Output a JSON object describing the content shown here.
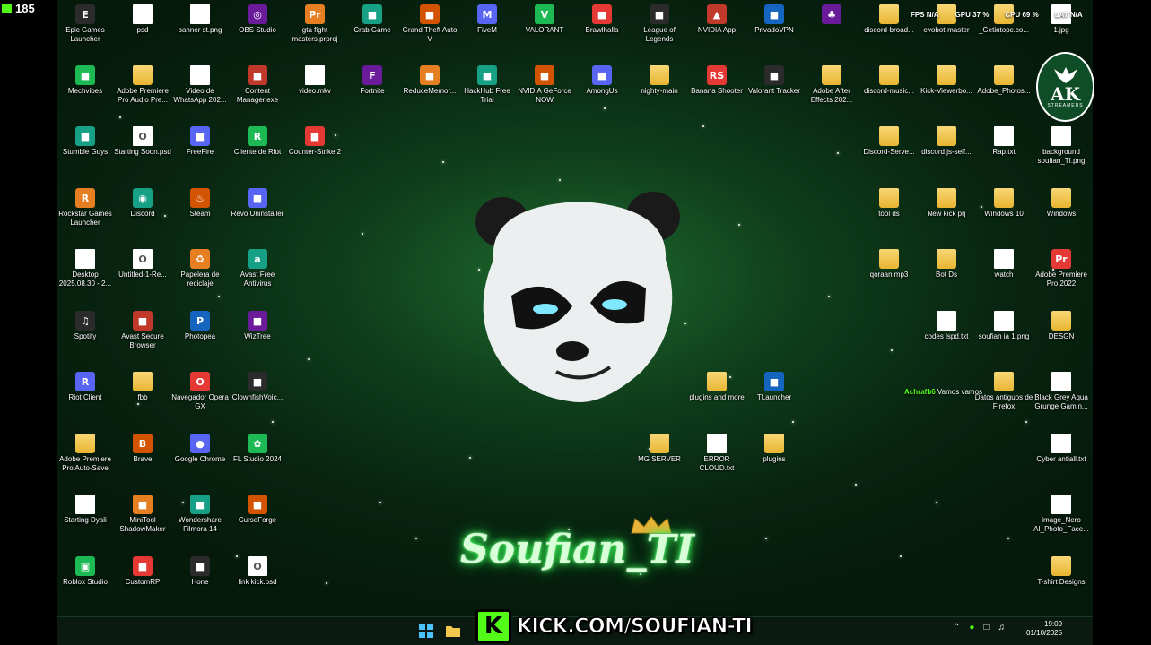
{
  "viewer_count": "185",
  "perf_overlay": {
    "fps": "FPS N/A",
    "gpu": "GPU 37 %",
    "cpu": "CPU 69 %",
    "lat": "LAT N/A"
  },
  "ak_logo": {
    "text": "AK",
    "subtext": "STREAMERS"
  },
  "streamer_name": "Soufian_TI",
  "chat": {
    "user": "Achrafb6",
    "message": "Vamos vamos"
  },
  "kick_banner": {
    "url": "KICK.COM/SOUFIAN-TI"
  },
  "clock": {
    "time": "19:09",
    "date": "01/10/2025"
  },
  "colors": {
    "kick_green": "#53fc18",
    "desktop_green": "#0f3d1a"
  },
  "desktop_icons": [
    {
      "label": "Epic Games Launcher",
      "icon": "epic-games-icon",
      "type": "app"
    },
    {
      "label": "psd",
      "icon": "file-icon",
      "type": "file"
    },
    {
      "label": "banner st.png",
      "icon": "image-file-icon",
      "type": "file"
    },
    {
      "label": "OBS Studio",
      "icon": "obs-icon",
      "type": "app"
    },
    {
      "label": "gta fight masters.prproj",
      "icon": "premiere-project-icon",
      "type": "app"
    },
    {
      "label": "Crab Game",
      "icon": "crab-game-icon",
      "type": "app"
    },
    {
      "label": "Grand Theft Auto V",
      "icon": "gta-icon",
      "type": "app"
    },
    {
      "label": "FiveM",
      "icon": "fivem-icon",
      "type": "app"
    },
    {
      "label": "VALORANT",
      "icon": "valorant-icon",
      "type": "app"
    },
    {
      "label": "Brawlhalla",
      "icon": "brawlhalla-icon",
      "type": "app"
    },
    {
      "label": "League of Legends",
      "icon": "league-icon",
      "type": "app"
    },
    {
      "label": "NVIDIA App",
      "icon": "nvidia-icon",
      "type": "app"
    },
    {
      "label": "PrivadoVPN",
      "icon": "vpn-icon",
      "type": "app"
    },
    {
      "label": "",
      "icon": "tree-icon",
      "type": "app"
    },
    {
      "label": "discord-broad...",
      "icon": "folder-icon",
      "type": "folder"
    },
    {
      "label": "evobot-master",
      "icon": "folder-icon",
      "type": "folder"
    },
    {
      "label": "_Getintopc.co...",
      "icon": "folder-icon",
      "type": "folder"
    },
    {
      "label": "1.jpg",
      "icon": "image-file-icon",
      "type": "file"
    },
    {
      "label": "Mechvibes",
      "icon": "mechvibes-icon",
      "type": "app"
    },
    {
      "label": "Adobe Premiere Pro Audio Pre...",
      "icon": "folder-icon",
      "type": "folder"
    },
    {
      "label": "Video de WhatsApp 202...",
      "icon": "video-file-icon",
      "type": "file"
    },
    {
      "label": "Content Manager.exe",
      "icon": "content-manager-icon",
      "type": "app"
    },
    {
      "label": "video.mkv",
      "icon": "video-file-icon",
      "type": "file"
    },
    {
      "label": "Fortnite",
      "icon": "fortnite-icon",
      "type": "app"
    },
    {
      "label": "ReduceMemor...",
      "icon": "ram-icon",
      "type": "app"
    },
    {
      "label": "HackHub Free Trial",
      "icon": "hackhub-icon",
      "type": "app"
    },
    {
      "label": "NVIDIA GeForce NOW",
      "icon": "geforce-now-icon",
      "type": "app"
    },
    {
      "label": "AmongUs",
      "icon": "among-us-icon",
      "type": "app"
    },
    {
      "label": "nighty-main",
      "icon": "folder-icon",
      "type": "folder"
    },
    {
      "label": "Banana Shooter",
      "icon": "banana-shooter-icon",
      "type": "app"
    },
    {
      "label": "Valorant Tracker",
      "icon": "valorant-tracker-icon",
      "type": "app"
    },
    {
      "label": "Adobe After Effects 202...",
      "icon": "folder-icon",
      "type": "folder"
    },
    {
      "label": "discord-music...",
      "icon": "folder-icon",
      "type": "folder"
    },
    {
      "label": "Kick-Viewerbo...",
      "icon": "folder-icon",
      "type": "folder"
    },
    {
      "label": "Adobe_Photos...",
      "icon": "folder-icon",
      "type": "folder"
    },
    {
      "label": "Stumble Guys",
      "icon": "stumble-guys-icon",
      "type": "app"
    },
    {
      "label": "Starting Soon.psd",
      "icon": "opera-icon",
      "type": "file"
    },
    {
      "label": "FreeFire",
      "icon": "freefire-icon",
      "type": "app"
    },
    {
      "label": "Cliente de Riot",
      "icon": "riot-icon",
      "type": "app"
    },
    {
      "label": "Counter-Strike 2",
      "icon": "cs2-icon",
      "type": "app"
    },
    {
      "label": "Discord-Serve...",
      "icon": "folder-icon",
      "type": "folder"
    },
    {
      "label": "discord.js-self...",
      "icon": "folder-icon",
      "type": "folder"
    },
    {
      "label": "Rap.txt",
      "icon": "text-file-icon",
      "type": "file"
    },
    {
      "label": "background soufian_TI.png",
      "icon": "image-file-icon",
      "type": "file"
    },
    {
      "label": "Rockstar Games Launcher",
      "icon": "rockstar-icon",
      "type": "app"
    },
    {
      "label": "Discord",
      "icon": "discord-icon",
      "type": "app"
    },
    {
      "label": "Steam",
      "icon": "steam-icon",
      "type": "app"
    },
    {
      "label": "Revo Uninstaller",
      "icon": "revo-icon",
      "type": "app"
    },
    {
      "label": "tool ds",
      "icon": "folder-icon",
      "type": "folder"
    },
    {
      "label": "New kick prj",
      "icon": "folder-icon",
      "type": "folder"
    },
    {
      "label": "Windows 10",
      "icon": "folder-icon",
      "type": "folder"
    },
    {
      "label": "Windows",
      "icon": "folder-icon",
      "type": "folder"
    },
    {
      "label": "Desktop 2025.08.30 - 2...",
      "icon": "video-file-icon",
      "type": "file"
    },
    {
      "label": "Untitled-1-Re...",
      "icon": "opera-icon",
      "type": "file"
    },
    {
      "label": "Papelera de reciclaje",
      "icon": "recycle-bin-icon",
      "type": "app"
    },
    {
      "label": "Avast Free Antivirus",
      "icon": "avast-icon",
      "type": "app"
    },
    {
      "label": "qoraan mp3",
      "icon": "folder-icon",
      "type": "folder"
    },
    {
      "label": "Bot Ds",
      "icon": "folder-icon",
      "type": "folder"
    },
    {
      "label": "watch",
      "icon": "chrome-file-icon",
      "type": "file"
    },
    {
      "label": "Adobe Premiere Pro 2022",
      "icon": "premiere-icon",
      "type": "app"
    },
    {
      "label": "Spotify",
      "icon": "spotify-icon",
      "type": "app"
    },
    {
      "label": "Avast Secure Browser",
      "icon": "avast-browser-icon",
      "type": "app"
    },
    {
      "label": "Photopea",
      "icon": "photopea-icon",
      "type": "app"
    },
    {
      "label": "WizTree",
      "icon": "wiztree-icon",
      "type": "app"
    },
    {
      "label": "codes lspd.txt",
      "icon": "text-file-icon",
      "type": "file"
    },
    {
      "label": "soufian ia 1.png",
      "icon": "image-file-icon",
      "type": "file"
    },
    {
      "label": "DESGN",
      "icon": "folder-icon",
      "type": "folder"
    },
    {
      "label": "Riot Client",
      "icon": "riot-client-icon",
      "type": "app"
    },
    {
      "label": "fbb",
      "icon": "folder-icon",
      "type": "folder"
    },
    {
      "label": "Navegador Opera GX",
      "icon": "opera-gx-icon",
      "type": "app"
    },
    {
      "label": "ClownfishVoic...",
      "icon": "clownfish-icon",
      "type": "app"
    },
    {
      "label": "plugins and more",
      "icon": "folder-icon",
      "type": "folder"
    },
    {
      "label": "TLauncher",
      "icon": "tlauncher-icon",
      "type": "app"
    },
    {
      "label": "Datos antiguos de Firefox",
      "icon": "folder-icon",
      "type": "folder"
    },
    {
      "label": "Black Grey Aqua Grunge Gamin...",
      "icon": "image-file-icon",
      "type": "file"
    },
    {
      "label": "Adobe Premiere Pro Auto-Save",
      "icon": "folder-icon",
      "type": "folder"
    },
    {
      "label": "Brave",
      "icon": "brave-icon",
      "type": "app"
    },
    {
      "label": "Google Chrome",
      "icon": "chrome-icon",
      "type": "app"
    },
    {
      "label": "FL Studio 2024",
      "icon": "fl-studio-icon",
      "type": "app"
    },
    {
      "label": "MG SERVER",
      "icon": "folder-icon",
      "type": "folder"
    },
    {
      "label": "ERROR CLOUD.txt",
      "icon": "text-file-icon",
      "type": "file"
    },
    {
      "label": "plugins",
      "icon": "folder-icon",
      "type": "folder"
    },
    {
      "label": "Cyber antiall.txt",
      "icon": "text-file-icon",
      "type": "file"
    },
    {
      "label": "Starting Dyali",
      "icon": "file-icon",
      "type": "file"
    },
    {
      "label": "MiniTool ShadowMaker",
      "icon": "minitool-icon",
      "type": "app"
    },
    {
      "label": "Wondershare Filmora 14",
      "icon": "filmora-icon",
      "type": "app"
    },
    {
      "label": "CurseForge",
      "icon": "curseforge-icon",
      "type": "app"
    },
    {
      "label": "image_Nero AI_Photo_Face...",
      "icon": "image-file-icon",
      "type": "file"
    },
    {
      "label": "Roblox Studio",
      "icon": "roblox-icon",
      "type": "app"
    },
    {
      "label": "CustomRP",
      "icon": "customrp-icon",
      "type": "app"
    },
    {
      "label": "Hone",
      "icon": "hone-icon",
      "type": "app"
    },
    {
      "label": "link kick.psd",
      "icon": "opera-icon",
      "type": "file"
    },
    {
      "label": "T-shirt Designs",
      "icon": "folder-icon",
      "type": "folder"
    }
  ]
}
